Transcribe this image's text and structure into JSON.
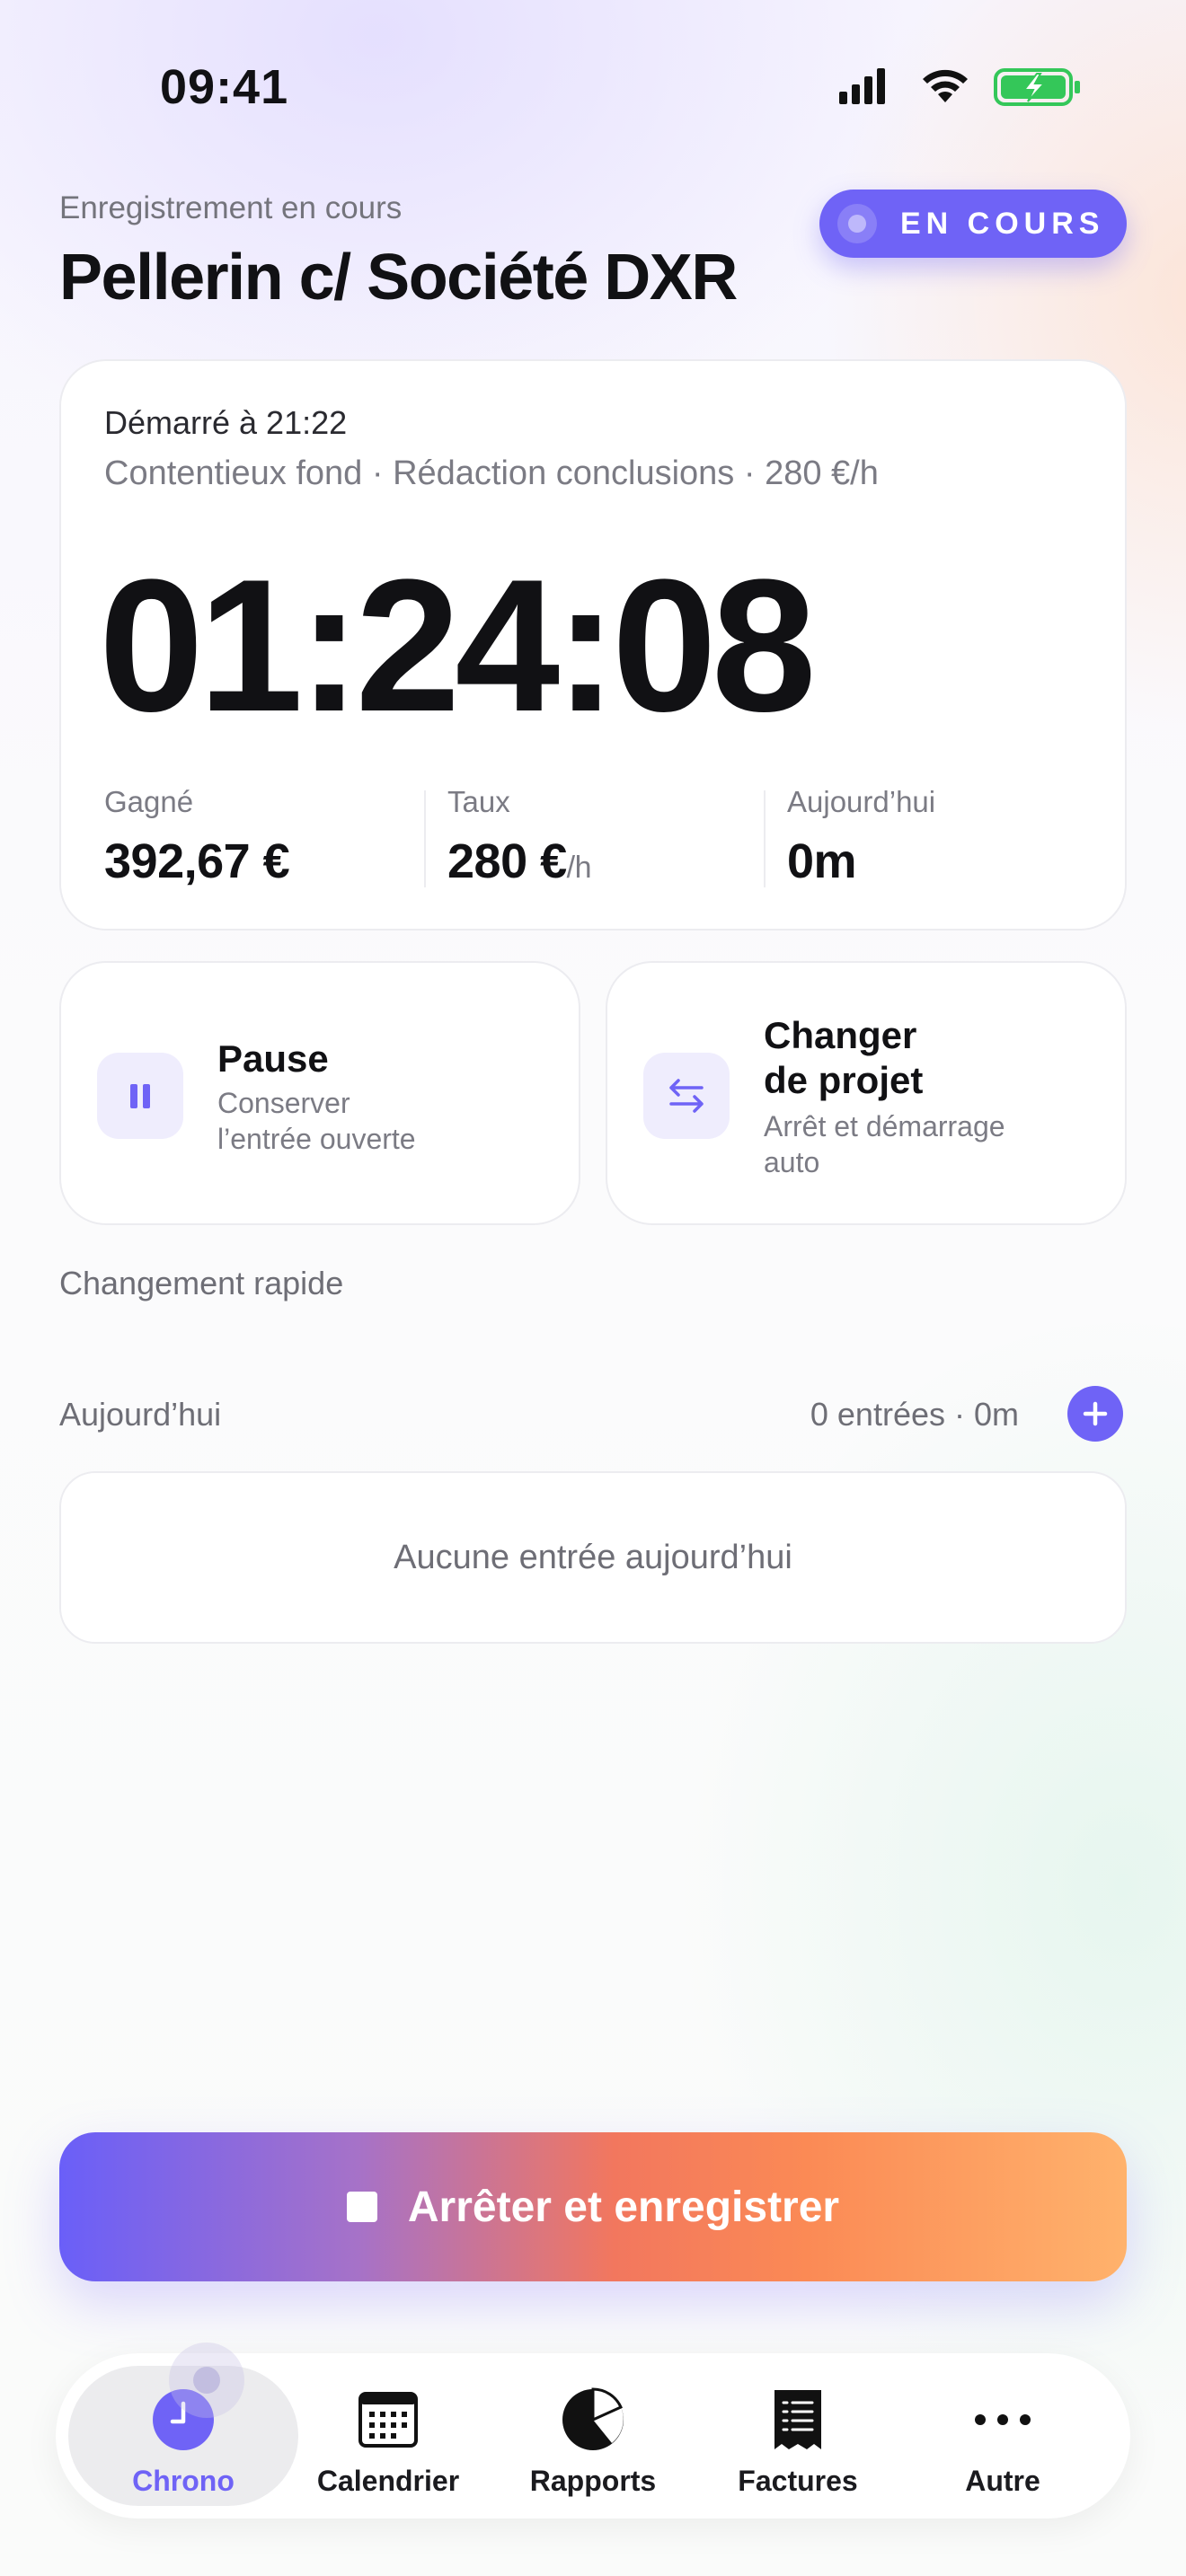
{
  "status_bar": {
    "time": "09:41"
  },
  "header": {
    "subtitle": "Enregistrement en cours",
    "title": "Pellerin c/ Société DXR",
    "badge": "EN COURS"
  },
  "timer": {
    "started": "Démarré à 21:22",
    "meta": "Contentieux fond · Rédaction conclusions · 280 €/h",
    "elapsed": "01:24:08",
    "stats": [
      {
        "label": "Gagné",
        "value": "392,67 €",
        "unit": ""
      },
      {
        "label": "Taux",
        "value": "280 €",
        "unit": "/h"
      },
      {
        "label": "Aujourd’hui",
        "value": "0m",
        "unit": ""
      }
    ]
  },
  "actions": {
    "pause": {
      "title": "Pause",
      "subtitle_line1": "Conserver",
      "subtitle_line2": "l’entrée ouverte",
      "icon": "pause-icon"
    },
    "switch": {
      "title_line1": "Changer",
      "title_line2": "de projet",
      "subtitle_line1": "Arrêt et démarrage",
      "subtitle_line2": "auto",
      "icon": "swap-arrows-icon"
    }
  },
  "quick_switch": {
    "label": "Changement rapide"
  },
  "today": {
    "label": "Aujourd’hui",
    "summary": "0 entrées · 0m",
    "empty": "Aucune entrée aujourd’hui"
  },
  "stop_button": {
    "label": "Arrêter et enregistrer"
  },
  "tabs": [
    {
      "label": "Chrono",
      "icon": "clock-icon",
      "active": true
    },
    {
      "label": "Calendrier",
      "icon": "calendar-icon",
      "active": false
    },
    {
      "label": "Rapports",
      "icon": "pie-chart-icon",
      "active": false
    },
    {
      "label": "Factures",
      "icon": "receipt-icon",
      "active": false
    },
    {
      "label": "Autre",
      "icon": "more-icon",
      "active": false
    }
  ],
  "colors": {
    "accent": "#6f63f6",
    "gradient_start": "#6a5ff8",
    "gradient_mid": "#f2775e",
    "gradient_end": "#ffb26c",
    "battery": "#34c759"
  }
}
